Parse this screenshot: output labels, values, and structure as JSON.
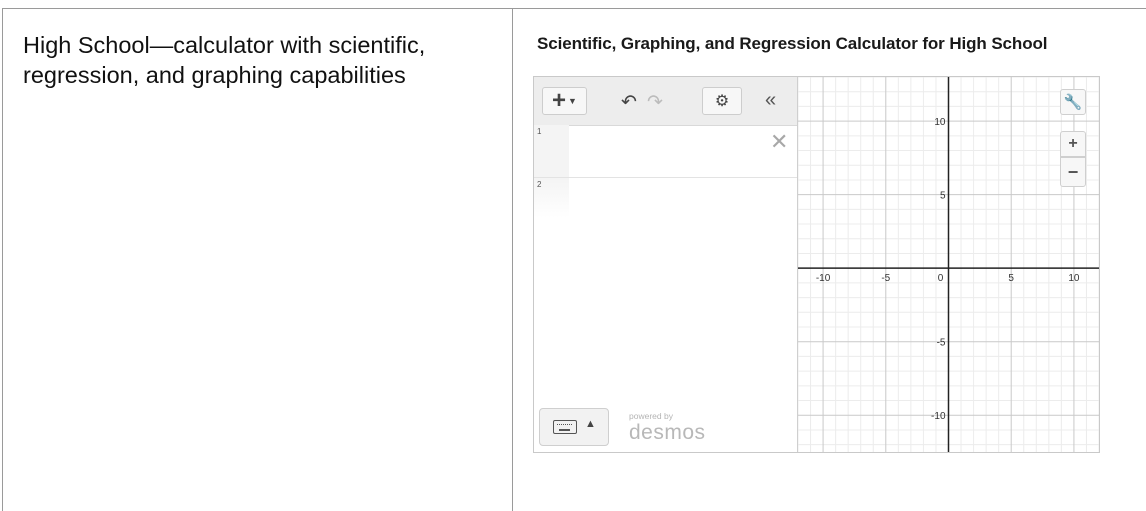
{
  "left_cell": {
    "description": "High School—calculator with scientific, regression, and graphing capabilities"
  },
  "right_cell": {
    "title": "Scientific, Graphing, and Regression Calculator for High School"
  },
  "calculator": {
    "toolbar": {
      "add_icon": "plus-icon",
      "undo_icon": "undo-icon",
      "redo_icon": "redo-icon",
      "settings_icon": "gear-icon",
      "collapse_icon": "double-chevron-left-icon"
    },
    "expressions": [
      {
        "number": "1",
        "value": ""
      },
      {
        "number": "2",
        "value": ""
      }
    ],
    "footer": {
      "keyboard_icon": "keyboard-icon",
      "powered_by": "powered by",
      "brand": "desmos"
    },
    "graph": {
      "x_range": [
        -12,
        12
      ],
      "y_range": [
        -12.5,
        13
      ],
      "major_step": 5,
      "minor_step": 1,
      "x_tick_labels": [
        "-10",
        "-5",
        "0",
        "5",
        "10"
      ],
      "y_tick_labels": [
        "10",
        "5",
        "-5",
        "-10"
      ],
      "grid": true,
      "tools": {
        "wrench_icon": "wrench-icon",
        "zoom_in_icon": "plus-icon",
        "zoom_out_icon": "minus-icon"
      }
    }
  }
}
